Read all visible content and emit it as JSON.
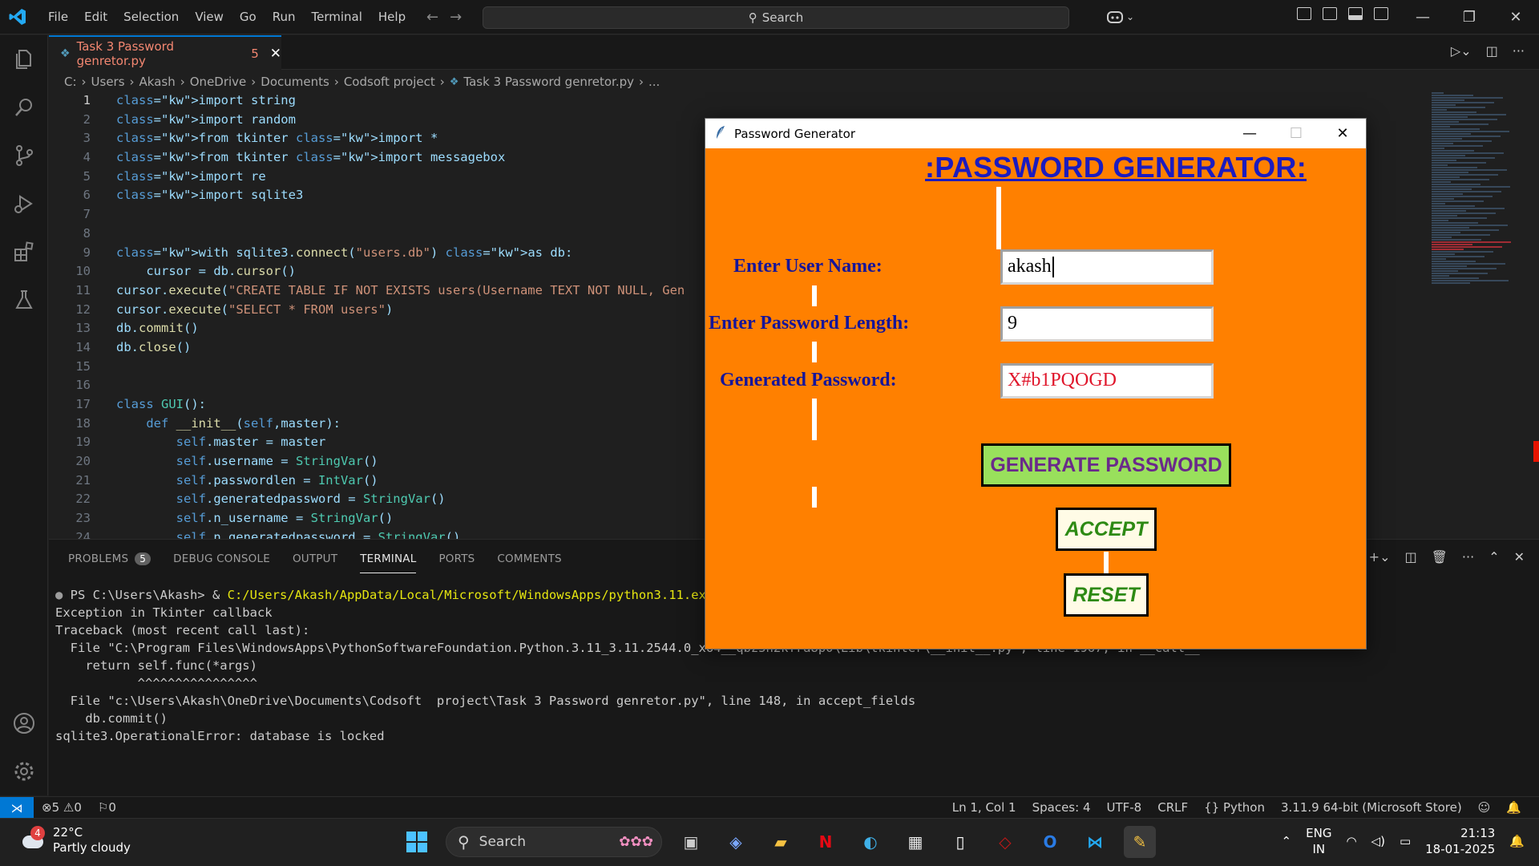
{
  "titlebar": {
    "menu": [
      "File",
      "Edit",
      "Selection",
      "View",
      "Go",
      "Run",
      "Terminal",
      "Help"
    ],
    "search_placeholder": "Search"
  },
  "tab": {
    "name": "Task 3 Password genretor.py",
    "problem_count": "5"
  },
  "breadcrumb": [
    "C:",
    "Users",
    "Akash",
    "OneDrive",
    "Documents",
    "Codsoft  project",
    "Task 3 Password genretor.py",
    "..."
  ],
  "code_lines": [
    {
      "n": "1",
      "text": "import string"
    },
    {
      "n": "2",
      "text": "import random"
    },
    {
      "n": "3",
      "text": "from tkinter import *"
    },
    {
      "n": "4",
      "text": "from tkinter import messagebox"
    },
    {
      "n": "5",
      "text": "import re"
    },
    {
      "n": "6",
      "text": "import sqlite3"
    },
    {
      "n": "7",
      "text": ""
    },
    {
      "n": "8",
      "text": ""
    },
    {
      "n": "9",
      "text": "with sqlite3.connect(\"users.db\") as db:"
    },
    {
      "n": "10",
      "text": "    cursor = db.cursor()"
    },
    {
      "n": "11",
      "text": "cursor.execute(\"CREATE TABLE IF NOT EXISTS users(Username TEXT NOT NULL, Gen"
    },
    {
      "n": "12",
      "text": "cursor.execute(\"SELECT * FROM users\")"
    },
    {
      "n": "13",
      "text": "db.commit()"
    },
    {
      "n": "14",
      "text": "db.close()"
    },
    {
      "n": "15",
      "text": ""
    },
    {
      "n": "16",
      "text": ""
    },
    {
      "n": "17",
      "text": "class GUI():"
    },
    {
      "n": "18",
      "text": "    def __init__(self,master):"
    },
    {
      "n": "19",
      "text": "        self.master = master"
    },
    {
      "n": "20",
      "text": "        self.username = StringVar()"
    },
    {
      "n": "21",
      "text": "        self.passwordlen = IntVar()"
    },
    {
      "n": "22",
      "text": "        self.generatedpassword = StringVar()"
    },
    {
      "n": "23",
      "text": "        self.n_username = StringVar()"
    },
    {
      "n": "24",
      "text": "        self.n_generatedpassword = StringVar()"
    }
  ],
  "panel": {
    "tabs": [
      "PROBLEMS",
      "DEBUG CONSOLE",
      "OUTPUT",
      "TERMINAL",
      "PORTS",
      "COMMENTS"
    ],
    "problems_badge": "5",
    "active_tab": "TERMINAL",
    "terminal": {
      "prompt": "PS C:\\Users\\Akash> & ",
      "command": "C:/Users/Akash/AppData/Local/Microsoft/WindowsApps/python3.11.exe \"c",
      "lines": [
        "Exception in Tkinter callback",
        "Traceback (most recent call last):",
        "  File \"C:\\Program Files\\WindowsApps\\PythonSoftwareFoundation.Python.3.11_3.11.2544.0_x64__qbz5n2kfra8p0\\Lib\\tkinter\\__init__.py\", line 1967, in __call__",
        "    return self.func(*args)",
        "           ^^^^^^^^^^^^^^^^",
        "  File \"c:\\Users\\Akash\\OneDrive\\Documents\\Codsoft  project\\Task 3 Password genretor.py\", line 148, in accept_fields",
        "    db.commit()",
        "sqlite3.OperationalError: database is locked"
      ]
    }
  },
  "statusbar": {
    "errors": "5",
    "warnings": "0",
    "ports": "0",
    "position": "Ln 1, Col 1",
    "spaces": "Spaces: 4",
    "encoding": "UTF-8",
    "eol": "CRLF",
    "language": "Python",
    "interpreter": "3.11.9 64-bit (Microsoft Store)"
  },
  "taskbar": {
    "weather_badge": "4",
    "temperature": "22°C",
    "condition": "Partly cloudy",
    "search": "Search",
    "lang_top": "ENG",
    "lang_bottom": "IN",
    "time": "21:13",
    "date": "18-01-2025"
  },
  "tk_app": {
    "window_title": "Password Generator",
    "heading": ":PASSWORD GENERATOR:",
    "label_username": "Enter User Name:",
    "label_length": "Enter Password Length:",
    "label_generated": "Generated Password:",
    "username_value": "akash",
    "length_value": "9",
    "generated_value": "X#b1PQOGD",
    "generate_button": "GENERATE PASSWORD",
    "accept_button": "ACCEPT",
    "reset_button": "RESET",
    "colors": {
      "background": "#ff8000",
      "heading": "#1b1bbf",
      "generate_bg": "#99e05c",
      "password_text": "#e0162b"
    }
  }
}
